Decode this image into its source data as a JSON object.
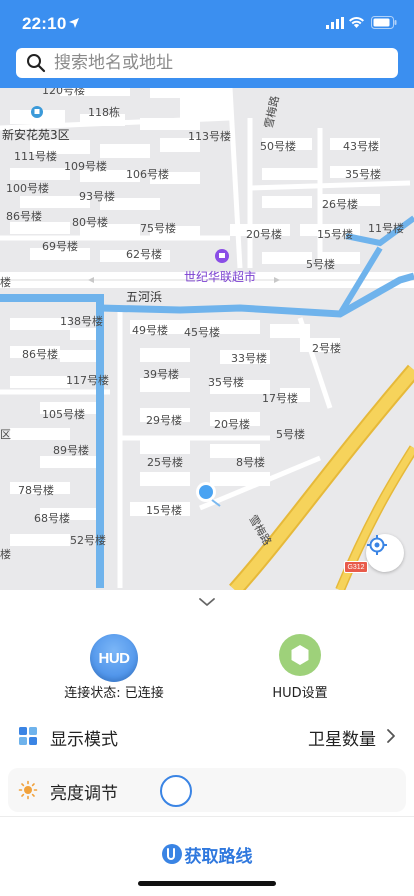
{
  "status_bar": {
    "time": "22:10"
  },
  "search": {
    "placeholder": "搜索地名或地址"
  },
  "map": {
    "labels": [
      {
        "text": "120号楼"
      },
      {
        "text": "118栋"
      },
      {
        "text": "新安花苑3区"
      },
      {
        "text": "113号楼"
      },
      {
        "text": "雪梅路"
      },
      {
        "text": "111号楼"
      },
      {
        "text": "109号楼"
      },
      {
        "text": "106号楼"
      },
      {
        "text": "50号楼"
      },
      {
        "text": "43号楼"
      },
      {
        "text": "100号楼"
      },
      {
        "text": "93号楼"
      },
      {
        "text": "35号楼"
      },
      {
        "text": "86号楼"
      },
      {
        "text": "80号楼"
      },
      {
        "text": "26号楼"
      },
      {
        "text": "75号楼"
      },
      {
        "text": "20号楼"
      },
      {
        "text": "15号楼"
      },
      {
        "text": "11号楼"
      },
      {
        "text": "69号楼"
      },
      {
        "text": "62号楼"
      },
      {
        "text": "5号楼"
      },
      {
        "text": "世纪华联超市"
      },
      {
        "text": "五河浜"
      },
      {
        "text": "138号楼"
      },
      {
        "text": "49号楼"
      },
      {
        "text": "45号楼"
      },
      {
        "text": "2号楼"
      },
      {
        "text": "86号楼"
      },
      {
        "text": "33号楼"
      },
      {
        "text": "117号楼"
      },
      {
        "text": "39号楼"
      },
      {
        "text": "35号楼"
      },
      {
        "text": "17号楼"
      },
      {
        "text": "105号楼"
      },
      {
        "text": "29号楼"
      },
      {
        "text": "20号楼"
      },
      {
        "text": "5号楼"
      },
      {
        "text": "区"
      },
      {
        "text": "89号楼"
      },
      {
        "text": "25号楼"
      },
      {
        "text": "8号楼"
      },
      {
        "text": "78号楼"
      },
      {
        "text": "68号楼"
      },
      {
        "text": "15号楼"
      },
      {
        "text": "52号楼"
      },
      {
        "text": "雪梅路"
      },
      {
        "text": "楼"
      },
      {
        "text": "楼"
      }
    ],
    "road_badge": "G312"
  },
  "hud": {
    "icon_text": "HUD",
    "connection_label": "连接状态: 已连接",
    "settings_label": "HUD设置"
  },
  "display_mode": {
    "title": "显示模式",
    "value": "卫星数量"
  },
  "brightness": {
    "title": "亮度调节",
    "level": 0
  },
  "route": {
    "label": "获取路线"
  },
  "colors": {
    "primary": "#3b8ff0",
    "accent_blue": "#2f78de",
    "hud_settings_green": "#9ed17a",
    "road_yellow": "#f6d35b",
    "river_blue": "#6fb3ec"
  }
}
